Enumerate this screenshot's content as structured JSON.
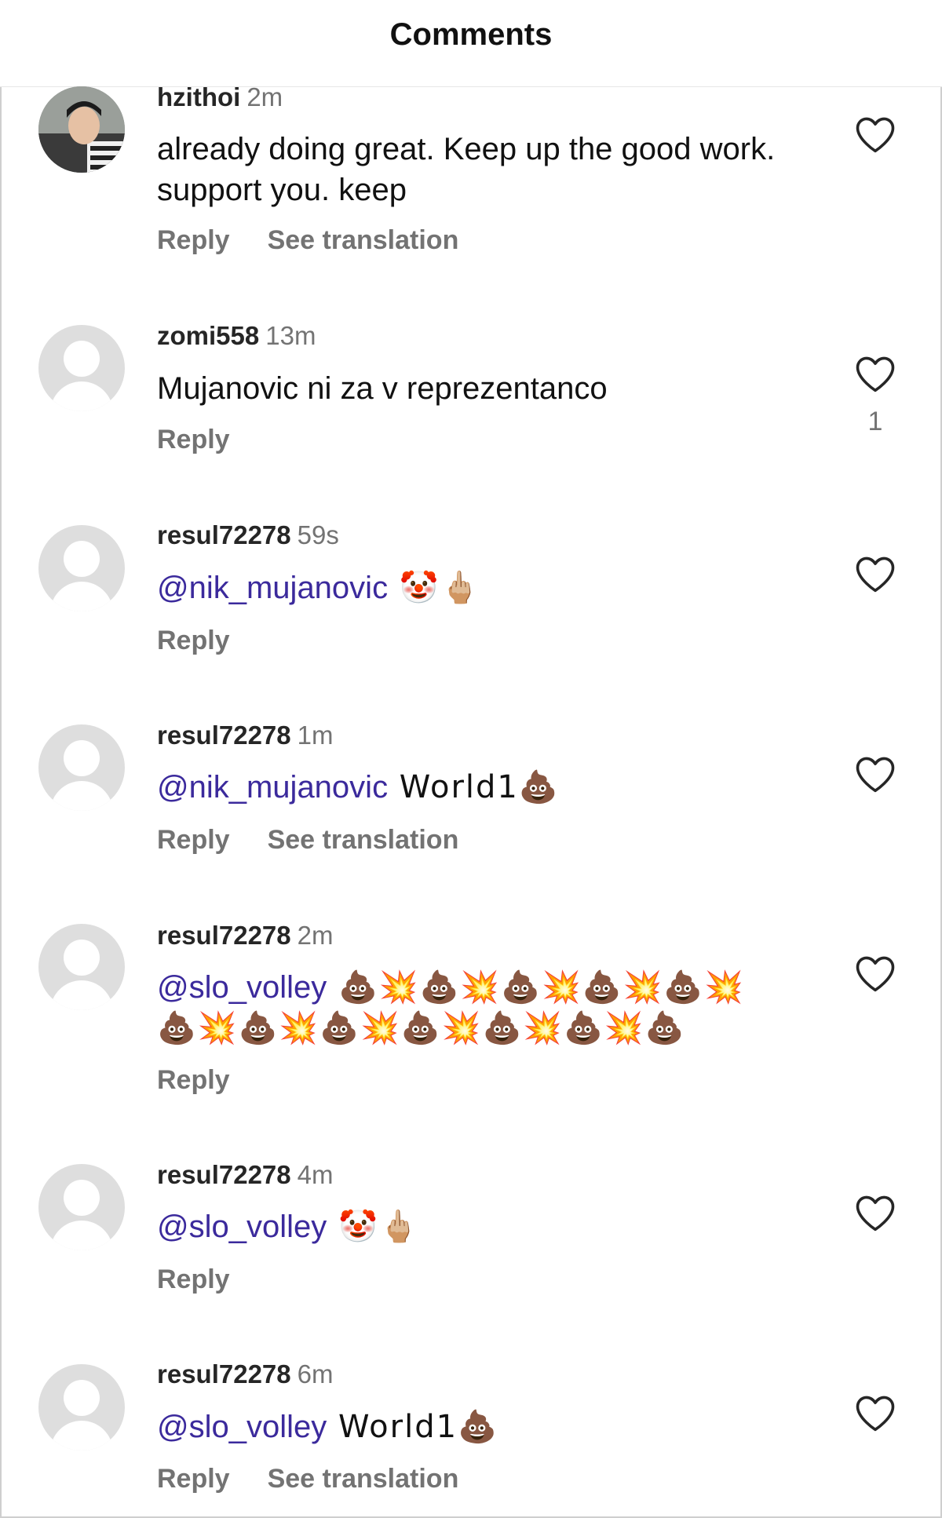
{
  "header": {
    "title": "Comments"
  },
  "comments": [
    {
      "user": "hzithoi",
      "time": "2m",
      "text": "already doing great. Keep up the good work. support you.  keep",
      "reply": "Reply",
      "translate": "See translation"
    },
    {
      "user": "zomi558",
      "time": "13m",
      "text": "Mujanovic ni za v reprezentanco",
      "reply": "Reply",
      "likes": "1"
    },
    {
      "user": "resul72278",
      "time": "59s",
      "mention": "@nik_mujanovic",
      "text": " 🤡🖕🏼",
      "reply": "Reply"
    },
    {
      "user": "resul72278",
      "time": "1m",
      "mention": "@nik_mujanovic",
      "text": " World1💩",
      "reply": "Reply",
      "translate": "See translation"
    },
    {
      "user": "resul72278",
      "time": "2m",
      "mention": "@slo_volley",
      "text": " 💩💥💩💥💩💥💩💥💩💥💩💥💩💥💩💥💩💥💩💥💩💥💩",
      "reply": "Reply"
    },
    {
      "user": "resul72278",
      "time": "4m",
      "mention": "@slo_volley",
      "text": " 🤡🖕🏼",
      "reply": "Reply"
    },
    {
      "user": "resul72278",
      "time": "6m",
      "mention": "@slo_volley",
      "text": " World1💩",
      "reply": "Reply",
      "translate": "See translation"
    }
  ],
  "icons": {
    "like": "heart-outline-icon",
    "avatar_default": "default-avatar-icon"
  }
}
